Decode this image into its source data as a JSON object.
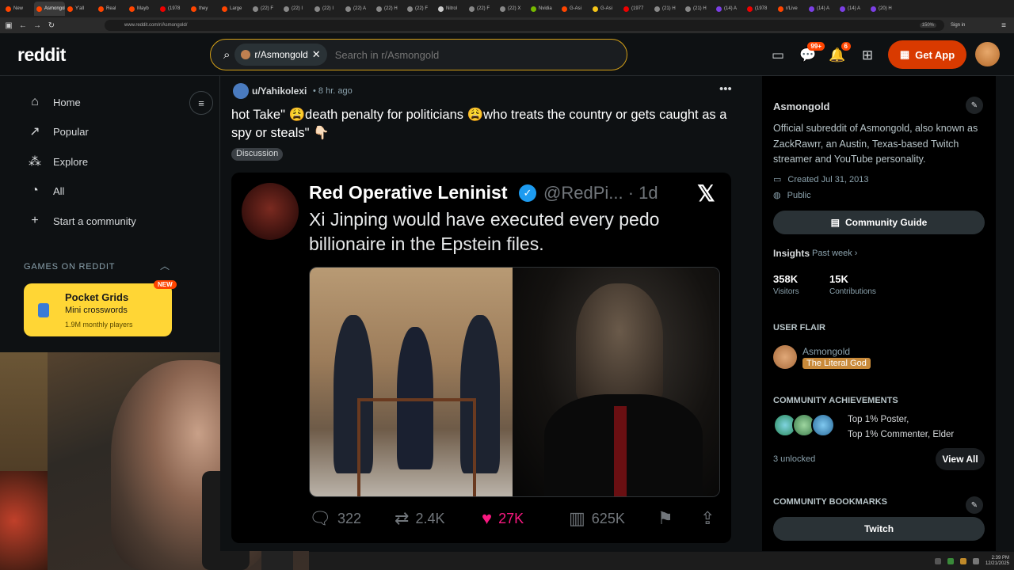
{
  "browser": {
    "tabs": [
      {
        "label": "New",
        "color": "#ff4500",
        "active": false
      },
      {
        "label": "Asmongold",
        "color": "#ff4500",
        "active": true
      },
      {
        "label": "Y'all",
        "color": "#ff4500",
        "active": false
      },
      {
        "label": "Real",
        "color": "#ff4500",
        "active": false
      },
      {
        "label": "Mayb",
        "color": "#ff4500",
        "active": false
      },
      {
        "label": "(1978",
        "color": "#e00",
        "active": false
      },
      {
        "label": "they",
        "color": "#ff4500",
        "active": false
      },
      {
        "label": "Large",
        "color": "#ff4500",
        "active": false
      },
      {
        "label": "(22) F",
        "color": "#888",
        "active": false
      },
      {
        "label": "(22) I",
        "color": "#888",
        "active": false
      },
      {
        "label": "(22) I",
        "color": "#888",
        "active": false
      },
      {
        "label": "(22) A",
        "color": "#888",
        "active": false
      },
      {
        "label": "(22) H",
        "color": "#888",
        "active": false
      },
      {
        "label": "(22) F",
        "color": "#888",
        "active": false
      },
      {
        "label": "Nitrol",
        "color": "#ccc",
        "active": false
      },
      {
        "label": "(22) F",
        "color": "#888",
        "active": false
      },
      {
        "label": "(22) X",
        "color": "#888",
        "active": false
      },
      {
        "label": "Nvidia",
        "color": "#76b900",
        "active": false
      },
      {
        "label": "G-Asi",
        "color": "#ff4500",
        "active": false
      },
      {
        "label": "G-Asi",
        "color": "#f5c518",
        "active": false
      },
      {
        "label": "(1977",
        "color": "#e00",
        "active": false
      },
      {
        "label": "(21) H",
        "color": "#888",
        "active": false
      },
      {
        "label": "(21) H",
        "color": "#888",
        "active": false
      },
      {
        "label": "(14) A",
        "color": "#7b3fe4",
        "active": false
      },
      {
        "label": "(1978",
        "color": "#e00",
        "active": false
      },
      {
        "label": "r/Live",
        "color": "#ff4500",
        "active": false
      },
      {
        "label": "(14) A",
        "color": "#7b3fe4",
        "active": false
      },
      {
        "label": "(14) A",
        "color": "#7b3fe4",
        "active": false
      },
      {
        "label": "(20) H",
        "color": "#7b3fe4",
        "active": false
      }
    ],
    "url": "www.reddit.com/r/Asmongold/",
    "zoom": "150%",
    "signin": "Sign in"
  },
  "header": {
    "logo": "reddit",
    "chip_label": "r/Asmongold",
    "search_placeholder": "Search in r/Asmongold",
    "chat_badge": "99+",
    "notif_badge": "6",
    "get_app": "Get App"
  },
  "leftnav": {
    "items": [
      {
        "label": "Home",
        "icon": "home-icon",
        "glyph": "⌂"
      },
      {
        "label": "Popular",
        "icon": "popular-icon",
        "glyph": "↗"
      },
      {
        "label": "Explore",
        "icon": "explore-icon",
        "glyph": "⁂"
      },
      {
        "label": "All",
        "icon": "all-icon",
        "glyph": "◔"
      },
      {
        "label": "Start a community",
        "icon": "plus-icon",
        "glyph": "+"
      }
    ],
    "games_label": "GAMES ON REDDIT",
    "game": {
      "title": "Pocket Grids",
      "subtitle": "Mini crosswords",
      "players": "1.9M monthly players",
      "badge": "NEW"
    }
  },
  "post": {
    "user": "u/Yahikolexi",
    "time": "• 8 hr. ago",
    "title": "hot Take\" 😩death penalty for politicians 😩who treats the country or gets caught as a spy or steals\" 👇🏻",
    "flair": "Discussion",
    "tweet": {
      "name": "Red Operative Leninist",
      "handle": "@RedPi... · 1d",
      "text": "Xi Jinping would have executed every pedo billionaire in the Epstein files.",
      "replies": "322",
      "retweets": "2.4K",
      "likes": "27K",
      "views": "625K",
      "like_color": "#f91880"
    }
  },
  "rightbar": {
    "name": "Asmongold",
    "description": "Official subreddit of Asmongold, also known as ZackRawrr, an Austin, Texas-based Twitch streamer and YouTube personality.",
    "created": "Created Jul 31, 2013",
    "visibility": "Public",
    "guide_btn": "Community Guide",
    "insights": "Insights",
    "past_week": "Past week ›",
    "visitors_num": "358K",
    "visitors_lbl": "Visitors",
    "contrib_num": "15K",
    "contrib_lbl": "Contributions",
    "user_flair_lbl": "USER FLAIR",
    "flair_name": "Asmongold",
    "flair_tag": "The Literal God",
    "achievements_lbl": "COMMUNITY ACHIEVEMENTS",
    "achievements_line1": "Top 1% Poster,",
    "achievements_line2": "Top 1% Commenter, Elder",
    "unlocked": "3 unlocked",
    "view_all": "View All",
    "bookmarks_lbl": "COMMUNITY BOOKMARKS",
    "bookmark1": "Twitch"
  },
  "taskbar": {
    "time": "2:39 PM",
    "date": "12/21/2025"
  }
}
